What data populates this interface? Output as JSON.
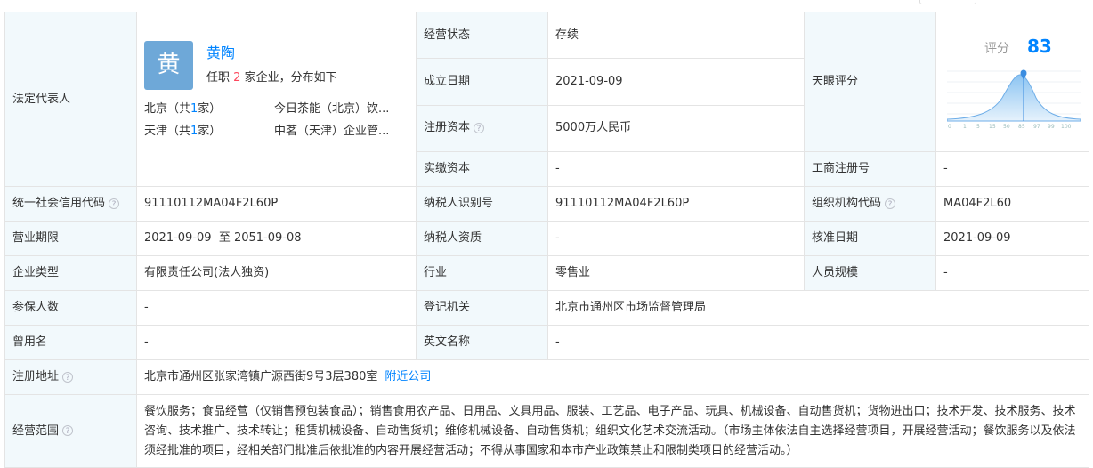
{
  "legal_rep": {
    "label": "法定代表人",
    "avatar_char": "黄",
    "name": "黄陶",
    "tenure_prefix": "任职",
    "tenure_count": "2",
    "tenure_suffix": "家企业，分布如下",
    "locations": [
      {
        "city": "北京（共",
        "count": "1",
        "unit": "家）",
        "company": "今日茶能（北京）饮..."
      },
      {
        "city": "天津（共",
        "count": "1",
        "unit": "家）",
        "company": "中茗（天津）企业管..."
      }
    ]
  },
  "status": {
    "label": "经营状态",
    "value": "存续"
  },
  "founded": {
    "label": "成立日期",
    "value": "2021-09-09"
  },
  "reg_capital": {
    "label": "注册资本",
    "value": "5000万人民币"
  },
  "paid_capital": {
    "label": "实缴资本",
    "value": "-"
  },
  "tianyan": {
    "label": "天眼评分",
    "score_label": "评分",
    "score": "83",
    "axis": [
      "0",
      "1",
      "5",
      "15",
      "50",
      "85",
      "97",
      "99",
      "100"
    ]
  },
  "biz_reg_no": {
    "label": "工商注册号",
    "value": "-"
  },
  "credit_code": {
    "label": "统一社会信用代码",
    "value": "91110112MA04F2L60P"
  },
  "taxpayer_id": {
    "label": "纳税人识别号",
    "value": "91110112MA04F2L60P"
  },
  "org_code": {
    "label": "组织机构代码",
    "value": "MA04F2L60"
  },
  "term": {
    "label": "营业期限",
    "value": "2021-09-09  至 2051-09-08"
  },
  "taxpayer_qual": {
    "label": "纳税人资质",
    "value": "-"
  },
  "approval_date": {
    "label": "核准日期",
    "value": "2021-09-09"
  },
  "company_type": {
    "label": "企业类型",
    "value": "有限责任公司(法人独资)"
  },
  "industry": {
    "label": "行业",
    "value": "零售业"
  },
  "staff_size": {
    "label": "人员规模",
    "value": "-"
  },
  "insured": {
    "label": "参保人数",
    "value": "-"
  },
  "reg_authority": {
    "label": "登记机关",
    "value": "北京市通州区市场监督管理局"
  },
  "former_name": {
    "label": "曾用名",
    "value": "-"
  },
  "english_name": {
    "label": "英文名称",
    "value": "-"
  },
  "address": {
    "label": "注册地址",
    "value": "北京市通州区张家湾镇广源西街9号3层380室",
    "link": "附近公司"
  },
  "scope": {
    "label": "经营范围",
    "value": "餐饮服务；食品经营（仅销售预包装食品）；销售食用农产品、日用品、文具用品、服装、工艺品、电子产品、玩具、机械设备、自动售货机；货物进出口；技术开发、技术服务、技术咨询、技术推广、技术转让；租赁机械设备、自动售货机；维修机械设备、自动售货机；组织文化艺术交流活动。（市场主体依法自主选择经营项目，开展经营活动；餐饮服务以及依法须经批准的项目，经相关部门批准后依批准的内容开展经营活动；不得从事国家和本市产业政策禁止和限制类项目的经营活动。）"
  },
  "colors": {
    "label_bg": "#f2f9fc",
    "link": "#0084ff",
    "accent_red": "#fd485e",
    "border": "#e4e4e4"
  }
}
